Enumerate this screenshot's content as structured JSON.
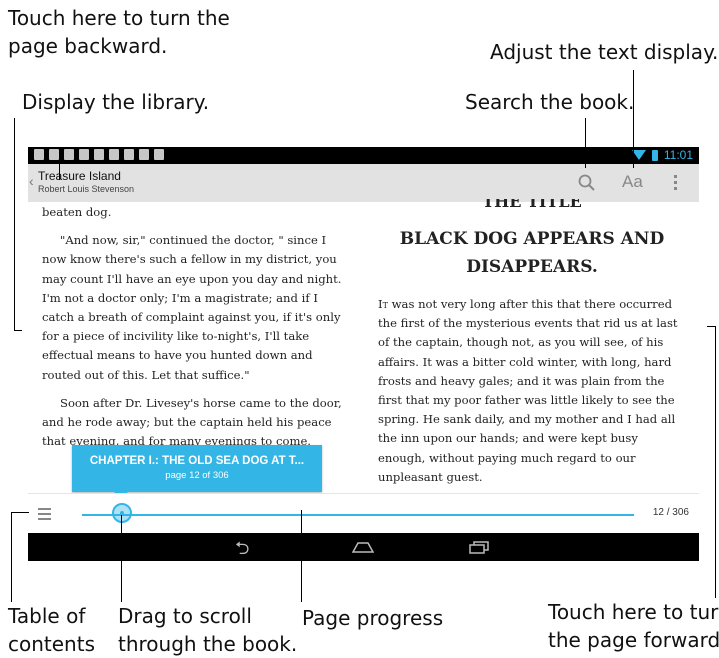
{
  "callouts": {
    "page_backward_line1": "Touch here to turn the",
    "page_backward_line2": "page backward.",
    "adjust_text": "Adjust the text display.",
    "display_library": "Display the library.",
    "search_book": "Search the book.",
    "toc_line1": "Table of",
    "toc_line2": "contents",
    "drag_line1": "Drag to scroll",
    "drag_line2": "through the  book.",
    "page_progress": "Page progress",
    "page_forward_line1": "Touch here to turn",
    "page_forward_line2": "the page forward."
  },
  "status_bar": {
    "time": "11:01",
    "icons": [
      "notification-icon",
      "mail-icon",
      "checkbox-icon",
      "chat-icon",
      "gmail-icon",
      "download-icon",
      "calendar-icon",
      "play-store-icon",
      "game-icon"
    ]
  },
  "action_bar": {
    "book_title": "Treasure Island",
    "book_author": "Robert Louis Stevenson",
    "text_display_label": "Aa"
  },
  "left_page": {
    "paragraphs": [
      "beaten dog.",
      "\"And now, sir,\" continued the doctor, \" since I now know there's such a fellow in my district, you may count I'll have an eye upon you day and night. I'm not a doctor only; I'm a magistrate; and if I catch a breath of complaint against you, if it's only for a piece of incivility like to-night's, I'll take effectual means to have you hunted down and routed out of this. Let that suffice.\"",
      "Soon after Dr. Livesey's horse came to the door, and he rode away; but the captain held his peace that evening, and for many evenings to come."
    ]
  },
  "right_page": {
    "cut_heading": "THE TITLE",
    "chapter_heading": "BLACK DOG APPEARS AND DISAPPEARS.",
    "lead_word": "It",
    "paragraph": " was not very long after this that there occurred the first of the mysterious events that rid us at last of the captain, though not, as you will see, of his affairs. It was a bitter cold winter, with long, hard frosts and heavy gales; and it was plain from the first that my poor father was little likely to see the spring. He sank daily, and my mother and I had all the inn upon our hands; and were kept busy enough, without paying much regard to our unpleasant guest."
  },
  "progress": {
    "popup_title": "CHAPTER I.: THE OLD SEA DOG AT T...",
    "popup_subtitle": "page 12 of 306",
    "page_count": "12 / 306",
    "current_page": 12,
    "total_pages": 306
  },
  "colors": {
    "accent": "#33b5e5",
    "action_bar": "#e2e2e2",
    "system_bar": "#000000"
  }
}
